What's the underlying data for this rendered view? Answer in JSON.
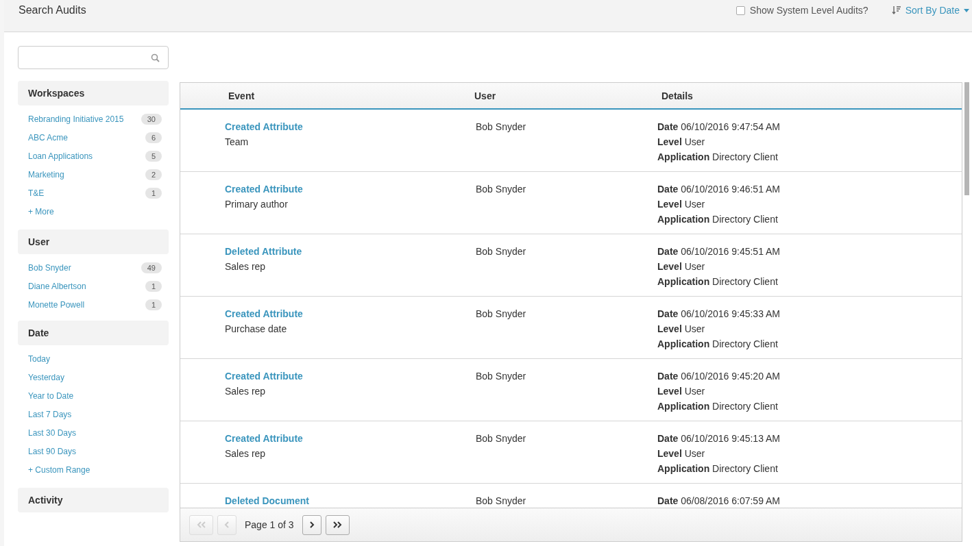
{
  "header": {
    "title": "Search Audits",
    "system_audits": {
      "label": "Show System Level Audits?",
      "checked": false
    },
    "sort": {
      "label": "Sort By Date"
    }
  },
  "sidebar": {
    "sections": [
      {
        "title": "Workspaces",
        "items": [
          {
            "label": "Rebranding Initiative 2015",
            "count": "30"
          },
          {
            "label": "ABC Acme",
            "count": "6"
          },
          {
            "label": "Loan Applications",
            "count": "5"
          },
          {
            "label": "Marketing",
            "count": "2"
          },
          {
            "label": "T&E",
            "count": "1"
          }
        ],
        "more": "+ More"
      },
      {
        "title": "User",
        "items": [
          {
            "label": "Bob Snyder",
            "count": "49"
          },
          {
            "label": "Diane Albertson",
            "count": "1"
          },
          {
            "label": "Monette Powell",
            "count": "1"
          }
        ]
      },
      {
        "title": "Date",
        "items": [
          {
            "label": "Today"
          },
          {
            "label": "Yesterday"
          },
          {
            "label": "Year to Date"
          },
          {
            "label": "Last 7 Days"
          },
          {
            "label": "Last 30 Days"
          },
          {
            "label": "Last 90 Days"
          }
        ],
        "more": "+ Custom Range"
      },
      {
        "title": "Activity"
      }
    ]
  },
  "table": {
    "columns": [
      "Event",
      "User",
      "Details"
    ],
    "rows": [
      {
        "event": "Created Attribute",
        "target": "Team",
        "user": "Bob Snyder",
        "details": [
          {
            "label": "Date",
            "value": "06/10/2016 9:47:54 AM"
          },
          {
            "label": "Level",
            "value": "User"
          },
          {
            "label": "Application",
            "value": "Directory Client"
          }
        ]
      },
      {
        "event": "Created Attribute",
        "target": "Primary author",
        "user": "Bob Snyder",
        "details": [
          {
            "label": "Date",
            "value": "06/10/2016 9:46:51 AM"
          },
          {
            "label": "Level",
            "value": "User"
          },
          {
            "label": "Application",
            "value": "Directory Client"
          }
        ]
      },
      {
        "event": "Deleted Attribute",
        "target": "Sales rep",
        "user": "Bob Snyder",
        "details": [
          {
            "label": "Date",
            "value": "06/10/2016 9:45:51 AM"
          },
          {
            "label": "Level",
            "value": "User"
          },
          {
            "label": "Application",
            "value": "Directory Client"
          }
        ]
      },
      {
        "event": "Created Attribute",
        "target": "Purchase date",
        "user": "Bob Snyder",
        "details": [
          {
            "label": "Date",
            "value": "06/10/2016 9:45:33 AM"
          },
          {
            "label": "Level",
            "value": "User"
          },
          {
            "label": "Application",
            "value": "Directory Client"
          }
        ]
      },
      {
        "event": "Created Attribute",
        "target": "Sales rep",
        "user": "Bob Snyder",
        "details": [
          {
            "label": "Date",
            "value": "06/10/2016 9:45:20 AM"
          },
          {
            "label": "Level",
            "value": "User"
          },
          {
            "label": "Application",
            "value": "Directory Client"
          }
        ]
      },
      {
        "event": "Created Attribute",
        "target": "Sales rep",
        "user": "Bob Snyder",
        "details": [
          {
            "label": "Date",
            "value": "06/10/2016 9:45:13 AM"
          },
          {
            "label": "Level",
            "value": "User"
          },
          {
            "label": "Application",
            "value": "Directory Client"
          }
        ]
      },
      {
        "event": "Deleted Document",
        "user": "Bob Snyder",
        "details": [
          {
            "label": "Date",
            "value": "06/08/2016 6:07:59 AM"
          }
        ]
      }
    ]
  },
  "pager": {
    "label": "Page 1 of 3",
    "first_disabled": true,
    "prev_disabled": true,
    "next_disabled": false,
    "last_disabled": false
  }
}
